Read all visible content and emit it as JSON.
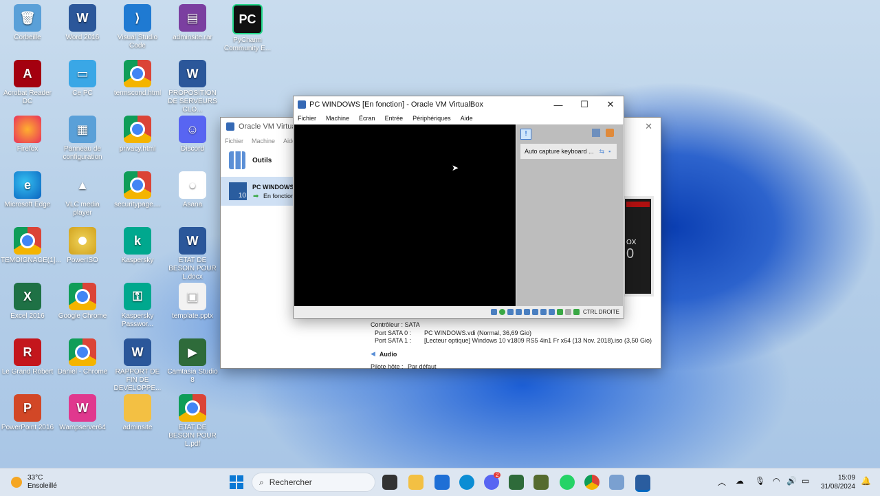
{
  "desktop": {
    "icons": [
      {
        "label": "Corbeille",
        "glyph": "🗑",
        "style": "panel"
      },
      {
        "label": "Word 2016",
        "glyph": "W",
        "style": "word"
      },
      {
        "label": "Visual Studio Code",
        "glyph": "⟩",
        "style": "vscode"
      },
      {
        "label": "adminsite.rar",
        "glyph": "▤",
        "style": "rar"
      },
      {
        "label": "PyCharm Community E...",
        "glyph": "PC",
        "style": "pycharm"
      },
      {
        "label": "Acrobat Reader DC",
        "glyph": "A",
        "style": "acrobat"
      },
      {
        "label": "Ce PC",
        "glyph": "▭",
        "style": "pc"
      },
      {
        "label": "termscond.html",
        "glyph": "",
        "style": "chrome"
      },
      {
        "label": "PROPOSITION DE SERVEURS CLO...",
        "glyph": "W",
        "style": "word"
      },
      {
        "label": "Firefox",
        "glyph": "",
        "style": "firefox"
      },
      {
        "label": "Panneau de configuration",
        "glyph": "▦",
        "style": "panel"
      },
      {
        "label": "privacy.html",
        "glyph": "",
        "style": "chrome"
      },
      {
        "label": "Discord",
        "glyph": "☺",
        "style": "discord"
      },
      {
        "label": "Microsoft Edge",
        "glyph": "e",
        "style": "edge"
      },
      {
        "label": "VLC media player",
        "glyph": "▲",
        "style": "vlc"
      },
      {
        "label": "securitypage....",
        "glyph": "",
        "style": "chrome"
      },
      {
        "label": "Asana",
        "glyph": "●",
        "style": "asana"
      },
      {
        "label": "TEMOIGNAGE(1]...",
        "glyph": "",
        "style": "chrome"
      },
      {
        "label": "PowerISO",
        "glyph": "",
        "style": "poweriso"
      },
      {
        "label": "Kaspersky",
        "glyph": "k",
        "style": "kasp"
      },
      {
        "label": "ETAT DE BESOIN POUR L.docx",
        "glyph": "W",
        "style": "word"
      },
      {
        "label": "Excel 2016",
        "glyph": "X",
        "style": "excel"
      },
      {
        "label": "Google Chrome",
        "glyph": "",
        "style": "chrome"
      },
      {
        "label": "Kaspersky Passwor...",
        "glyph": "⚿",
        "style": "kasp"
      },
      {
        "label": "template.pptx",
        "glyph": "▣",
        "style": "template"
      },
      {
        "label": "Le Grand Robert",
        "glyph": "R",
        "style": "red"
      },
      {
        "label": "Daniel - Chrome",
        "glyph": "",
        "style": "chrome"
      },
      {
        "label": "RAPPORT DE FIN DE DEVELOPPE...",
        "glyph": "W",
        "style": "word"
      },
      {
        "label": "Camtasia Studio 8",
        "glyph": "▶",
        "style": "camtasia"
      },
      {
        "label": "PowerPoint 2016",
        "glyph": "P",
        "style": "ppt"
      },
      {
        "label": "Wampserver64",
        "glyph": "W",
        "style": "wamp"
      },
      {
        "label": "adminsite",
        "glyph": "",
        "style": "folder"
      },
      {
        "label": "ETAT DE BESOIN POUR L.pdf",
        "glyph": "",
        "style": "chrome"
      }
    ]
  },
  "manager": {
    "title": "Oracle VM VirtualB",
    "menu": [
      "Fichier",
      "Machine",
      "Aide"
    ],
    "tools_label": "Outils",
    "vm_name": "PC WINDOWS",
    "vm_state": "En fonction",
    "details": {
      "controller": "Contrôleur : SATA",
      "port0_label": "Port SATA 0 :",
      "port0_value": "PC WINDOWS.vdi (Normal, 36,69 Gio)",
      "port1_label": "Port SATA 1 :",
      "port1_value": "[Lecteur optique] Windows 10 v1809 RS5 4in1 Fr x64 (13 Nov. 2018).iso (3,50 Gio)",
      "audio_title": "Audio",
      "audio_driver_label": "Pilote hôte :",
      "audio_driver_value": "Par défaut"
    },
    "preview_text": "OX",
    "preview_digit": "0"
  },
  "vm_window": {
    "title": "PC WINDOWS [En fonction] - Oracle VM VirtualBox",
    "menu": [
      "Fichier",
      "Machine",
      "Écran",
      "Entrée",
      "Périphériques",
      "Aide"
    ],
    "notification": "Auto capture keyboard ...",
    "host_key": "CTRL DROITE"
  },
  "taskbar": {
    "weather_temp": "33°C",
    "weather_desc": "Ensoleillé",
    "search_placeholder": "Rechercher",
    "time": "15:09",
    "date": "31/08/2024",
    "discord_badge": "2"
  },
  "colors": {
    "accent": "#0067c0",
    "vm_screen": "#000000"
  }
}
